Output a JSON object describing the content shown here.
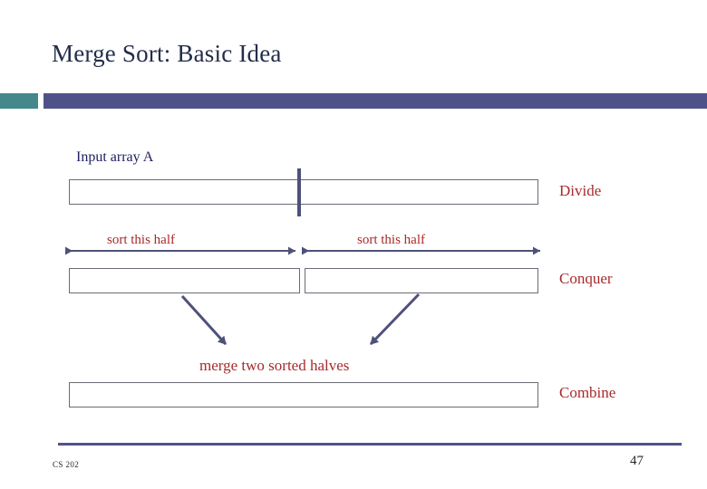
{
  "slide": {
    "title": "Merge Sort: Basic Idea",
    "colors": {
      "title_navy": "#232d4b",
      "accent_teal": "#44888a",
      "accent_purple": "#4f5288",
      "label_navy": "#1f2160",
      "label_red": "#a82a2a",
      "box_border": "#6b6b76",
      "arrow": "#4e5279"
    }
  },
  "diagram": {
    "input_label": "Input array A",
    "stage_labels": {
      "divide": "Divide",
      "conquer": "Conquer",
      "combine": "Combine"
    },
    "sort_left_label": "sort this half",
    "sort_right_label": "sort this half",
    "merge_label": "merge two sorted halves",
    "boxes": {
      "input_array": "",
      "left_half": "",
      "right_half": "",
      "merged_array": ""
    }
  },
  "footer": {
    "course": "CS 202",
    "page_number": "47"
  }
}
